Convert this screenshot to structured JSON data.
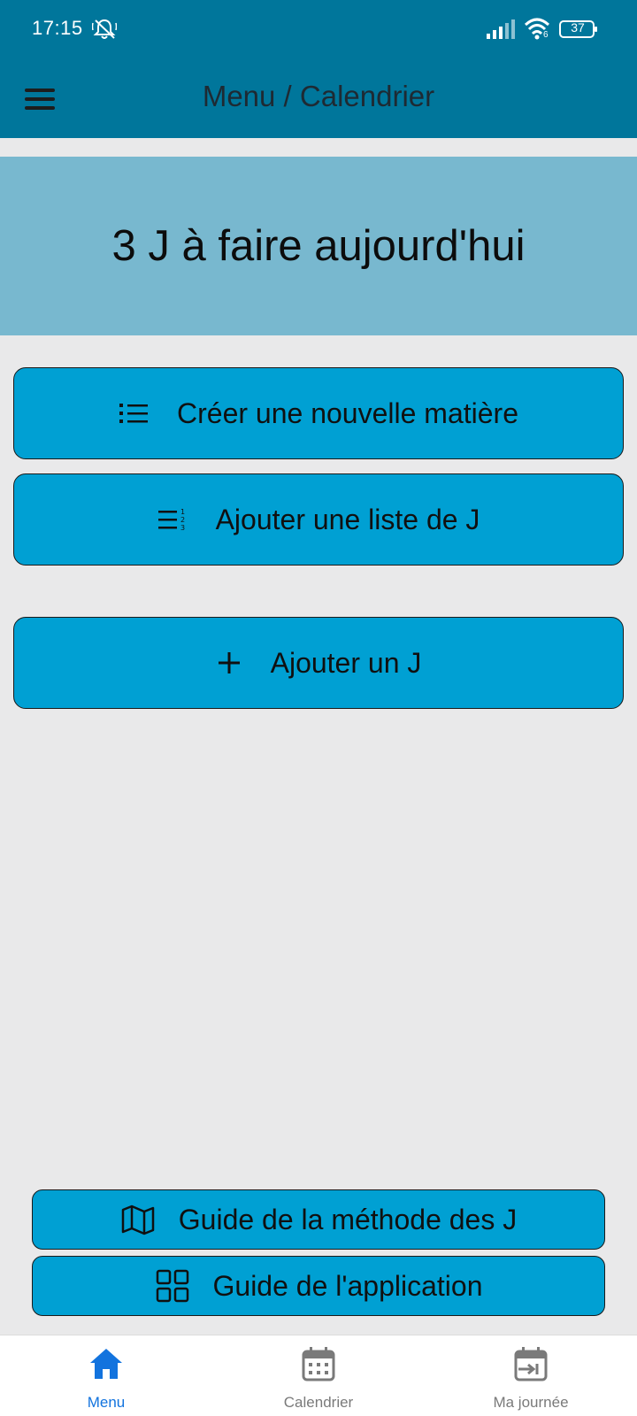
{
  "status_bar": {
    "time": "17:15",
    "battery": "37",
    "wifi_badge": "6",
    "icons": [
      "bell-off-icon",
      "signal-icon",
      "wifi-icon",
      "battery-icon"
    ]
  },
  "header": {
    "title": "Menu / Calendrier",
    "menu_icon": "hamburger-icon"
  },
  "hero": {
    "text": "3 J à faire aujourd'hui"
  },
  "actions": [
    {
      "label": "Créer une nouvelle matière",
      "icon": "list-icon"
    },
    {
      "label": "Ajouter une liste de J",
      "icon": "numbered-list-icon"
    },
    {
      "label": "Ajouter un J",
      "icon": "plus-icon"
    }
  ],
  "guides": [
    {
      "label": "Guide de la méthode des J",
      "icon": "map-icon"
    },
    {
      "label": "Guide de l'application",
      "icon": "grid-icon"
    }
  ],
  "bottom_nav": {
    "items": [
      {
        "label": "Menu",
        "icon": "home-icon",
        "active": true
      },
      {
        "label": "Calendrier",
        "icon": "calendar-icon",
        "active": false
      },
      {
        "label": "Ma journée",
        "icon": "calendar-arrow-icon",
        "active": false
      }
    ]
  },
  "colors": {
    "header": "#00769b",
    "hero": "#78b8cf",
    "button": "#00a0d3",
    "background": "#e9e9ea",
    "active_nav": "#1273de",
    "inactive_nav": "#7a7a7a"
  }
}
